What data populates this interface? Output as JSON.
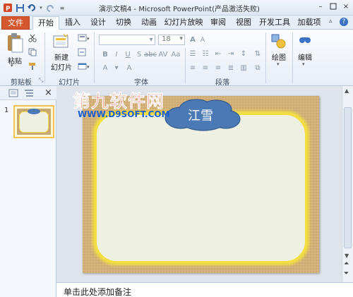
{
  "window": {
    "title": "演示文稿4 - Microsoft PowerPoint(产品激活失败)",
    "minimize": "–",
    "close": "×"
  },
  "tabs": [
    "文件",
    "开始",
    "插入",
    "设计",
    "切换",
    "动画",
    "幻灯片放映",
    "审阅",
    "视图",
    "开发工具",
    "加载项"
  ],
  "active_tab": "开始",
  "ribbon": {
    "clipboard": {
      "paste": "粘贴",
      "label": "剪贴板"
    },
    "slides": {
      "new_slide_line1": "新建",
      "new_slide_line2": "幻灯片",
      "label": "幻灯片"
    },
    "font": {
      "size": "18",
      "label": "字体"
    },
    "paragraph": {
      "label": "段落"
    },
    "drawing": {
      "label": "绘图"
    },
    "editing": {
      "label": "编辑"
    }
  },
  "slide_panel": {
    "slide_number": "1"
  },
  "slide": {
    "cloud_text": "江雪"
  },
  "notes": {
    "placeholder": "单击此处添加备注"
  },
  "watermark": {
    "line1": "第九软件网",
    "line2": "WWW.D9SOFT.COM"
  },
  "colors": {
    "file_tab": "#d4572e",
    "ribbon_bg": "#e7eef7",
    "cloud": "#4a79b5",
    "slide_glow": "#f5e64a"
  }
}
